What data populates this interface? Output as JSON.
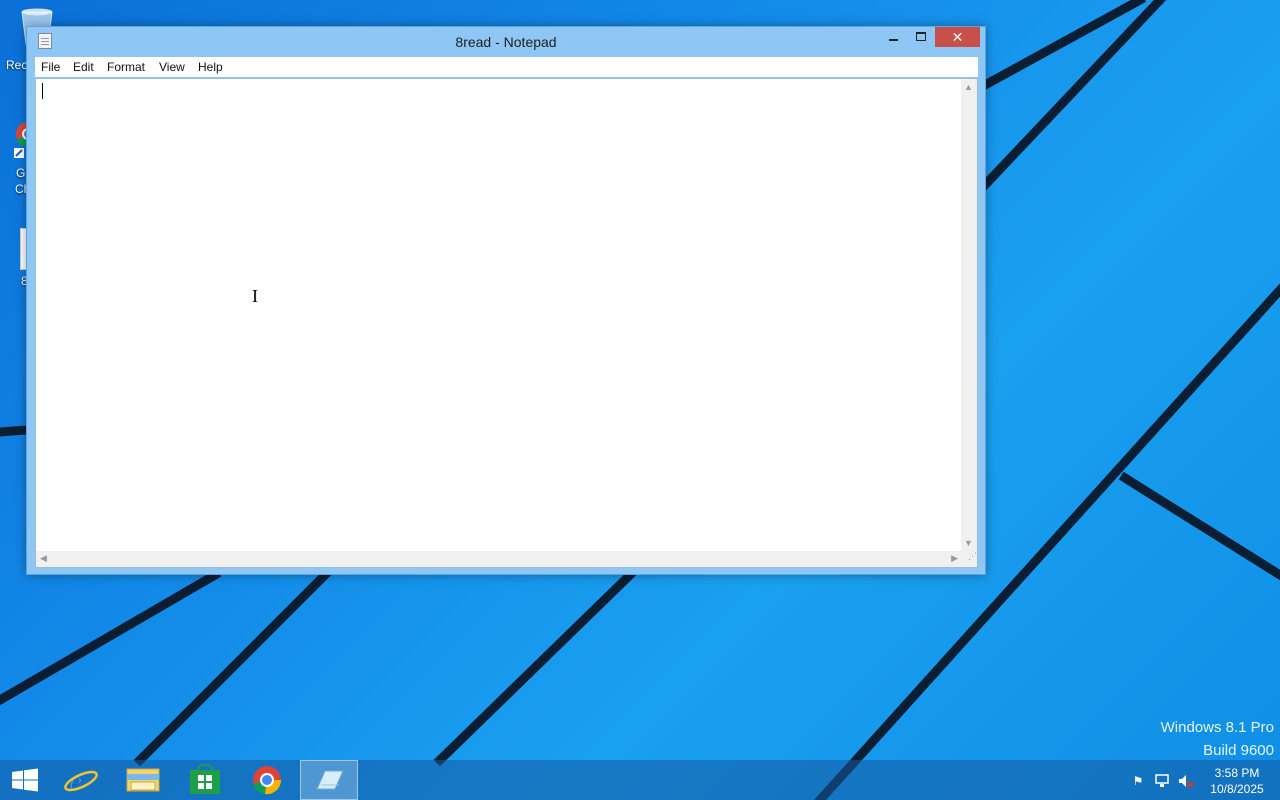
{
  "desktop": {
    "recycle_bin_label": "Rec",
    "chrome_label_line1": "G",
    "chrome_label_line2": "Ch",
    "file_label": "8"
  },
  "window": {
    "title": "8read - Notepad",
    "close_glyph": "✕",
    "menu": [
      "File",
      "Edit",
      "Format",
      "View",
      "Help"
    ],
    "content": ""
  },
  "watermark": {
    "line1": "Windows 8.1 Pro",
    "line2": "Build 9600"
  },
  "taskbar": {
    "apps": [
      "start-icon",
      "internet-explorer-icon",
      "file-explorer-icon",
      "store-icon",
      "chrome-icon",
      "notepad-icon"
    ],
    "active_app": "notepad-icon",
    "tray_icons": [
      "flag-icon",
      "network-icon",
      "volume-muted-icon"
    ]
  },
  "clock": {
    "time": "3:58 PM",
    "date": "10/8/2025"
  },
  "colors": {
    "desktop_blue": "#1289e8",
    "window_frame": "#8ec6f5",
    "close_button": "#c7504b"
  }
}
